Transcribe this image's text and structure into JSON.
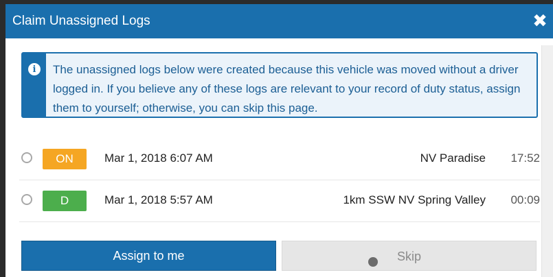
{
  "dialog": {
    "title": "Claim Unassigned Logs",
    "close_icon": "close-icon"
  },
  "info": {
    "icon": "info-icon",
    "icon_glyph": "i",
    "message": "The unassigned logs below were created because this vehicle was moved without a driver logged in. If you believe any of these logs are relevant to your record of duty status, assign them to yourself; otherwise, you can skip this page."
  },
  "logs": [
    {
      "status": "ON",
      "status_color": "#f5a623",
      "datetime": "Mar 1, 2018 6:07 AM",
      "location": "NV Paradise",
      "duration": "17:52"
    },
    {
      "status": "D",
      "status_color": "#4cae4c",
      "datetime": "Mar 1, 2018 5:57 AM",
      "location": "1km SSW NV Spring Valley",
      "duration": "00:09"
    }
  ],
  "actions": {
    "assign_label": "Assign to me",
    "skip_label": "Skip"
  },
  "colors": {
    "primary": "#1a6fad",
    "info_background": "#ebf3fa"
  }
}
